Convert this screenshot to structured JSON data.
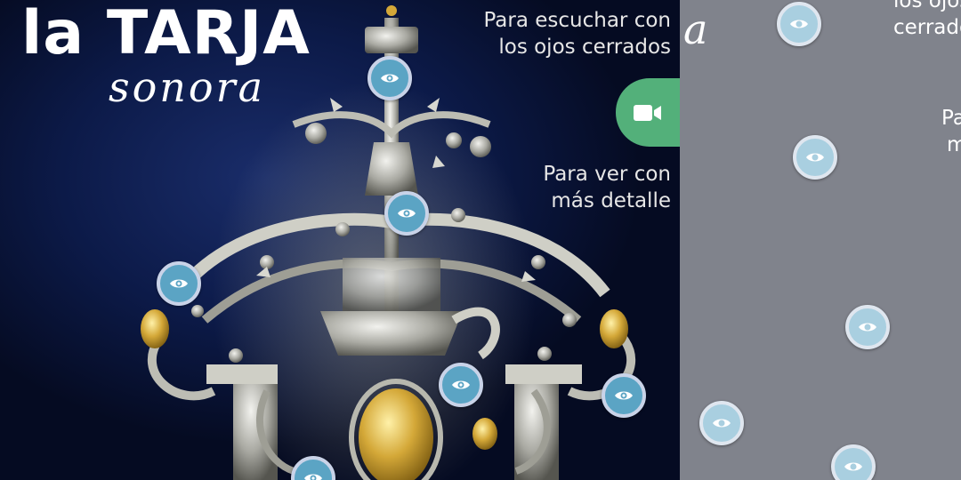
{
  "brand": {
    "title": "la TARJA",
    "subtitle": "sonora"
  },
  "listen": {
    "line1": "Para escuchar con",
    "line2": "los ojos cerrados"
  },
  "view": {
    "line1": "Para ver con",
    "line2": "más detalle"
  },
  "ghost": {
    "top_text": "los ojos cerrados",
    "fragment1": "Pa",
    "fragment2": "m",
    "title_fragment": "a"
  },
  "colors": {
    "accent_green": "#53b07a",
    "hotspot_blue": "#5ba4c4",
    "hotspot_ring": "#c9d3e8",
    "background": "#0c1a48"
  },
  "icons": {
    "video": "video-camera-icon",
    "hotspot": "eye-icon"
  }
}
